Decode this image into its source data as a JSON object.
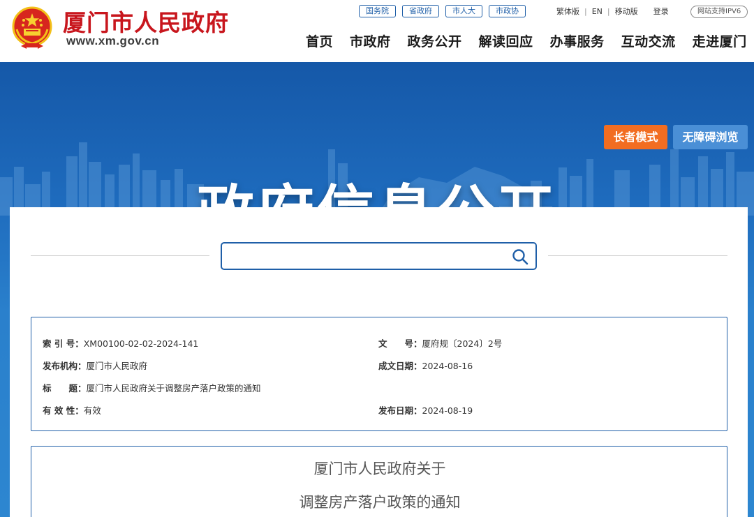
{
  "header": {
    "site_name": "厦门市人民政府",
    "domain": "www.xm.gov.cn",
    "links": [
      "国务院",
      "省政府",
      "市人大",
      "市政协"
    ],
    "util": {
      "traditional": "繁体版",
      "english": "EN",
      "mobile": "移动版",
      "login": "登录"
    },
    "ipv6": "网站支持IPV6",
    "nav": [
      "首页",
      "市政府",
      "政务公开",
      "解读回应",
      "办事服务",
      "互动交流",
      "走进厦门"
    ]
  },
  "banner": {
    "title": "政府信息公开",
    "elder_mode": "长者模式",
    "accessible": "无障碍浏览"
  },
  "search": {
    "placeholder": "",
    "value": ""
  },
  "meta": {
    "index_label": "索 引 号：",
    "index_value": "XM00100-02-02-2024-141",
    "docno_label": "文　　号：",
    "docno_value": "厦府规〔2024〕2号",
    "org_label": "发布机构：",
    "org_value": "厦门市人民政府",
    "created_label": "成文日期：",
    "created_value": "2024-08-16",
    "title_label": "标　　题：",
    "title_value": "厦门市人民政府关于调整房产落户政策的通知",
    "validity_label": "有 效 性：",
    "validity_value": "有效",
    "published_label": "发布日期：",
    "published_value": "2024-08-19"
  },
  "document": {
    "title_line1": "厦门市人民政府关于",
    "title_line2": "调整房产落户政策的通知"
  },
  "colors": {
    "brand_red": "#c8161d",
    "brand_blue": "#1f5fa8",
    "elder_orange": "#f26d21",
    "accessible_blue": "#4a8fd6"
  }
}
